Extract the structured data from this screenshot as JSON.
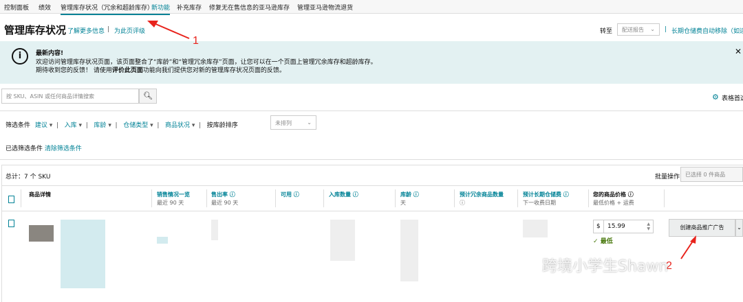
{
  "nav": {
    "items": [
      "控制面板",
      "绩效",
      "管理库存状况（冗余和超龄库存）",
      "新功能",
      "补充库存",
      "修复无在售信息的亚马逊库存",
      "管理亚马逊物流退货"
    ]
  },
  "header": {
    "title": "管理库存状况",
    "learn_more": "了解更多信息",
    "rate_page": "为此页评级",
    "goto_label": "转至",
    "goto_value": "配送报告",
    "ltsf_link": "长期仓储费自动移除（如适"
  },
  "banner": {
    "heading": "最新内容!",
    "line1": "欢迎访问管理库存状况页面，该页面整合了“库龄”和“管理冗余库存”页面，让您可以在一个页面上管理冗余库存和超龄库存。",
    "line2_a": "期待收到您的反馈！ 请使用",
    "line2_bold": "评价此页面",
    "line2_b": "功能向我们提供您对新的管理库存状况页面的反馈。",
    "icon": "info-icon",
    "close_icon": "close-icon"
  },
  "search": {
    "placeholder": "按 SKU、ASIN 或任何商品详情搜索",
    "icon": "search-icon"
  },
  "table_prefs": "表格首选",
  "filters": {
    "label": "筛选条件",
    "items": [
      "建议",
      "入库",
      "库龄",
      "仓储类型",
      "商品状况"
    ],
    "sort_label": "按库龄排序",
    "sort_value": "未排列",
    "applied_label": "已选筛选条件",
    "clear": "清除筛选条件"
  },
  "table": {
    "total": "总计：7 个 SKU",
    "bulk_label": "批量操作",
    "bulk_value": "已选择 0 件商品",
    "columns": [
      {
        "title": "商品详情",
        "sub": ""
      },
      {
        "title": "销售情况一览",
        "sub": "最近 90 天"
      },
      {
        "title": "售出率 ⓘ",
        "sub": "最近 90 天"
      },
      {
        "title": "可用 ⓘ",
        "sub": ""
      },
      {
        "title": "入库数量 ⓘ",
        "sub": ""
      },
      {
        "title": "库龄 ⓘ",
        "sub": "天"
      },
      {
        "title": "预计冗余商品数量",
        "sub": "ⓘ"
      },
      {
        "title": "预计长期仓储费 ⓘ",
        "sub": "下一收费日期"
      },
      {
        "title": "您的商品价格 ⓘ",
        "sub": "最低价格 + 运费"
      }
    ],
    "row": {
      "currency": "$",
      "price": "15.99",
      "price_status": "最低",
      "action": "创建商品推广广告"
    }
  },
  "annotations": {
    "one": "1",
    "two": "2",
    "color": "#e8231c"
  },
  "watermark": "跨境小学生Shawn",
  "colors": {
    "accent": "#008296",
    "banner_bg": "#e3f1f2",
    "ok": "#4b7a10"
  }
}
